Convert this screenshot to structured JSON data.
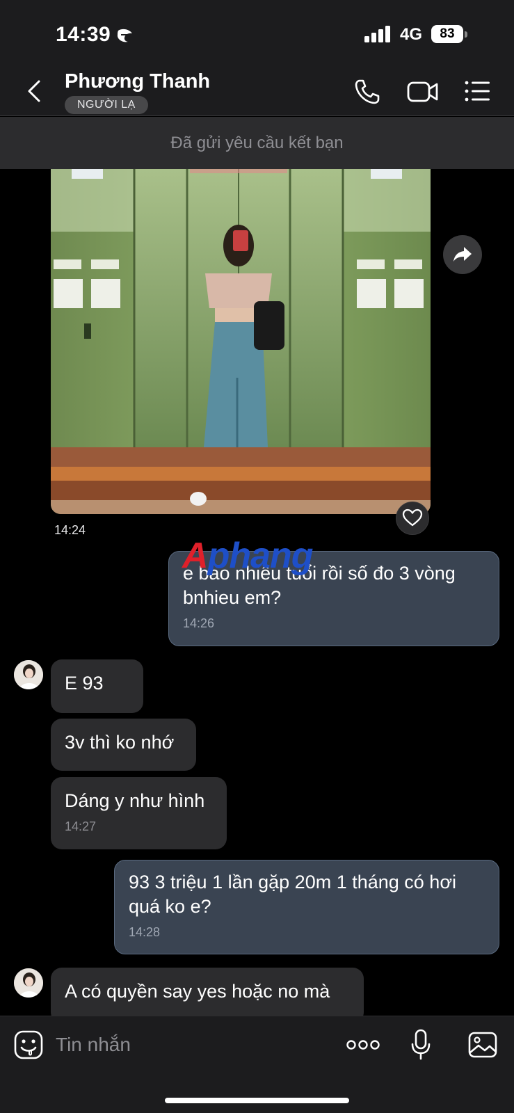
{
  "status_bar": {
    "time": "14:39",
    "network": "4G",
    "battery": "83"
  },
  "header": {
    "name": "Phương Thanh",
    "badge": "NGƯỜI LẠ"
  },
  "banner": {
    "text": "Đã gửi yêu cầu kết bạn"
  },
  "watermark": {
    "part1": "A",
    "part2": "phang"
  },
  "photo_message": {
    "time": "14:24"
  },
  "messages": [
    {
      "direction": "sent",
      "text": "e bao nhiêu tuổi rồi số đo 3 vòng bnhieu em?",
      "time": "14:26"
    },
    {
      "direction": "received",
      "text": "E 93"
    },
    {
      "direction": "received",
      "text": "3v thì ko nhớ"
    },
    {
      "direction": "received",
      "text": "Dáng y như hình",
      "time": "14:27"
    },
    {
      "direction": "sent",
      "text": "93 3 triệu 1 lần gặp 20m 1 tháng có hơi quá ko e?",
      "time": "14:28"
    },
    {
      "direction": "received",
      "text": "A có quyền say yes hoặc no mà"
    }
  ],
  "input": {
    "placeholder": "Tin nhắn"
  },
  "colors": {
    "sent_bubble": "#3a4452",
    "received_bubble": "#2c2c2e",
    "background": "#000000",
    "bar": "#1c1c1e"
  }
}
